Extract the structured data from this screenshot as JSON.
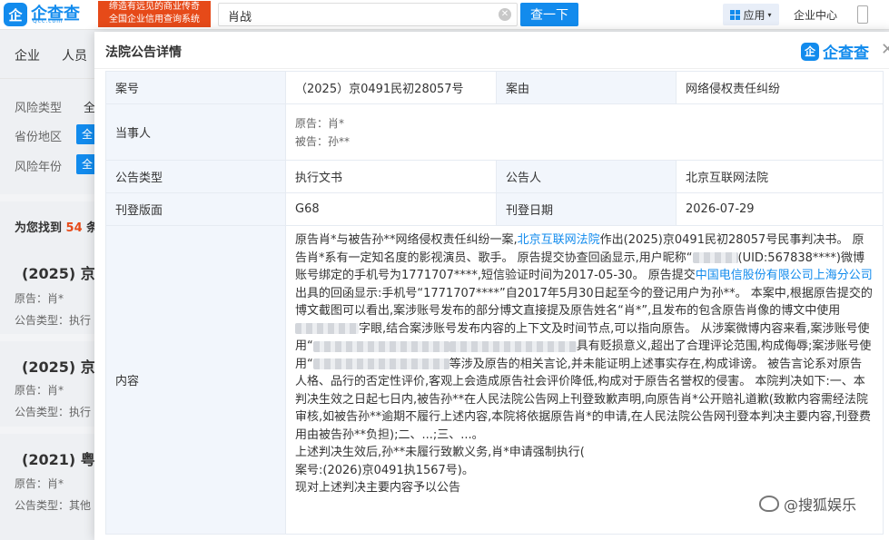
{
  "topbar": {
    "logo_mark": "企",
    "logo_text": "企查查",
    "logo_sub": "Qcc.com",
    "slogan_line1": "缔造有远见的商业传奇",
    "slogan_line2": "全国企业信用查询系统",
    "search_value": "肖战",
    "search_button": "查一下",
    "app_button": "应用",
    "enterprise_center": "企业中心"
  },
  "background": {
    "nav": [
      "企业",
      "人员"
    ],
    "filters": [
      {
        "label": "风险类型",
        "value": "全"
      },
      {
        "label": "省份地区",
        "value": "全"
      },
      {
        "label": "风险年份",
        "value": "全"
      }
    ],
    "found_prefix": "为您找到",
    "found_count": "54",
    "found_suffix": "条",
    "results": [
      {
        "title": "(2025) 京",
        "line1": "原告：肖*",
        "line2": "公告类型：执行"
      },
      {
        "title": "(2025) 京",
        "line1": "原告：肖*",
        "line2": "公告类型：执行"
      },
      {
        "title": "(2021) 粤",
        "line1": "原告：肖*",
        "line2": "公告类型：其他"
      }
    ]
  },
  "modal": {
    "title": "法院公告详情",
    "brand_mark": "企",
    "brand_text": "企查查",
    "rows": {
      "case_no_label": "案号",
      "case_no": "（2025）京0491民初28057号",
      "cause_label": "案由",
      "cause": "网络侵权责任纠纷",
      "party_label": "当事人",
      "plaintiff": "原告：肖*",
      "defendant": "被告：孙**",
      "type_label": "公告类型",
      "type": "执行文书",
      "announcer_label": "公告人",
      "announcer": "北京互联网法院",
      "page_label": "刊登版面",
      "page": "G68",
      "date_label": "刊登日期",
      "date": "2026-07-29",
      "content_label": "内容"
    },
    "content": {
      "p1a": "原告肖*与被告孙**网络侵权责任纠纷一案,",
      "court_link": "北京互联网法院",
      "p1b": "作出(2025)京0491民初28057号民事判决书。 原告肖*系有一定知名度的影视演员、歌手。 原告提交协查回函显示,用户昵称“",
      "p1c": "(UID:567838****)微博账号绑定的手机号为1771707****,短信验证时间为2017-05-30。 原告提交",
      "telecom_link": "中国电信股份有限公司上海分公司",
      "p1d": "出具的回函显示:手机号“1771707****”自2017年5月30日起至今的登记用户为孙**。 本案中,根据原告提交的博文截图可以看出,案涉账号发布的部分博文直接提及原告姓名“肖*”,且发布的包含原告肖像的博文中使用",
      "p1e": "字眼,结合案涉账号发布内容的上下文及时间节点,可以指向原告。 从涉案微博内容来看,案涉账号使用“",
      "p1f": "具有贬损意义,超出了合理评论范围,构成侮辱;案涉账号使用“",
      "p1g": "等涉及原告的相关言论,并未能证明上述事实存在,构成诽谤。 被告言论系对原告人格、品行的否定性评价,客观上会造成原告社会评价降低,构成对于原告名誉权的侵害。 本院判决如下:一、本判决生效之日起七日内,被告孙**在人民法院公告网上刊登致歉声明,向原告肖*公开赔礼道歉(致歉内容需经法院审核,如被告孙**逾期不履行上述内容,本院将依据原告肖*的申请,在人民法院公告网刊登本判决主要内容,刊登费用由被告孙**负担);二、...;三、...。",
      "p2": "上述判决生效后,孙**未履行致歉义务,肖*申请强制执行(",
      "p3": "案号:(2026)京0491执1567号)。",
      "p4": "现对上述判决主要内容予以公告"
    }
  },
  "watermark": {
    "text": "@搜狐娱乐"
  },
  "colors": {
    "brand_blue": "#128bed",
    "slogan_red": "#e64a19",
    "label_bg": "#f2f6fc"
  }
}
